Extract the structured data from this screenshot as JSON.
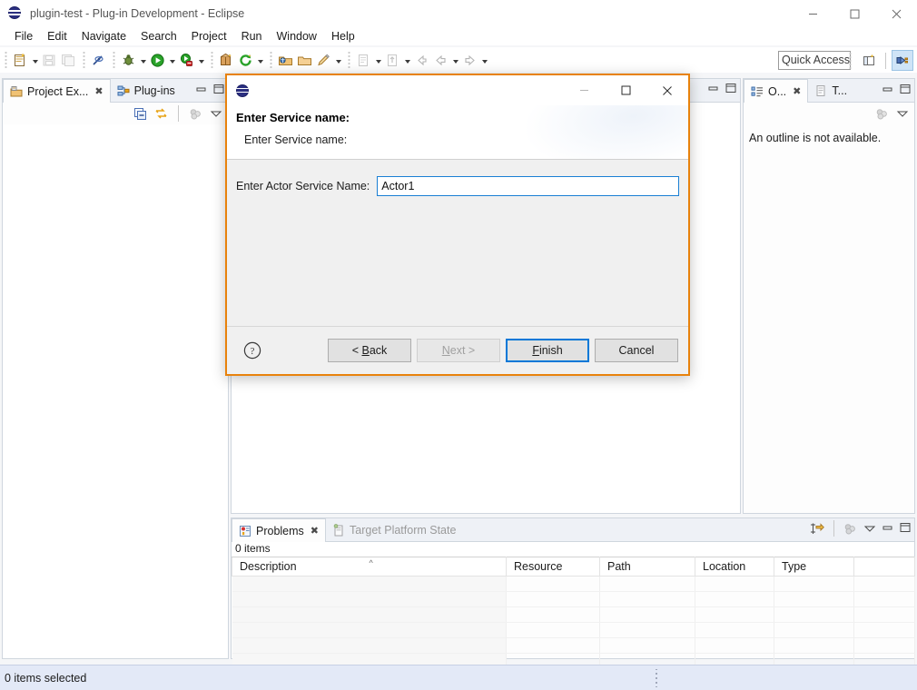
{
  "window": {
    "title": "plugin-test - Plug-in Development - Eclipse",
    "icon": "eclipse-globe-icon",
    "controls": [
      {
        "name": "minimize-button",
        "glyph": "minimize-icon"
      },
      {
        "name": "maximize-button",
        "glyph": "maximize-icon"
      },
      {
        "name": "close-button",
        "glyph": "close-icon"
      }
    ]
  },
  "menubar": {
    "items": [
      {
        "label": "File"
      },
      {
        "label": "Edit"
      },
      {
        "label": "Navigate"
      },
      {
        "label": "Search"
      },
      {
        "label": "Project"
      },
      {
        "label": "Run"
      },
      {
        "label": "Window"
      },
      {
        "label": "Help"
      }
    ]
  },
  "toolbar": {
    "quick_access_placeholder": "Quick Access",
    "buttons": [
      {
        "name": "new-wizard-button",
        "icon": "new-document-icon",
        "dropdown": true
      },
      {
        "name": "save-button",
        "icon": "save-disk-icon",
        "disabled": true
      },
      {
        "name": "save-all-button",
        "icon": "save-all-icon",
        "disabled": true
      },
      {
        "name": "toggle-mark-occurrences-button",
        "icon": "mark-occurrences-icon"
      },
      {
        "name": "debug-button",
        "icon": "bug-icon",
        "dropdown": true
      },
      {
        "name": "run-button",
        "icon": "run-green-play-icon",
        "dropdown": true
      },
      {
        "name": "run-external-tools-button",
        "icon": "external-tools-icon",
        "dropdown": true
      },
      {
        "name": "new-plugin-project-button",
        "icon": "plugin-package-icon"
      },
      {
        "name": "open-type-button",
        "icon": "refresh-green-icon",
        "dropdown": true
      },
      {
        "name": "open-package-button",
        "icon": "open-package-icon"
      },
      {
        "name": "open-folder-button",
        "icon": "open-folder-icon"
      },
      {
        "name": "edit-button",
        "icon": "pencil-icon",
        "dropdown": true
      },
      {
        "name": "new-java-file-button",
        "icon": "java-file-icon",
        "dropdown": true
      },
      {
        "name": "next-annotation-button",
        "icon": "next-annotation-icon",
        "dropdown": true
      },
      {
        "name": "previous-edit-location-button",
        "icon": "back-edit-icon"
      },
      {
        "name": "back-button",
        "icon": "arrow-left-icon",
        "dropdown": true
      },
      {
        "name": "forward-button",
        "icon": "arrow-right-icon",
        "dropdown": true
      }
    ],
    "perspective": {
      "open_perspective_name": "open-perspective-icon",
      "active_perspective_name": "plug-in-development-perspective-icon"
    }
  },
  "left_panel": {
    "tabs": [
      {
        "label": "Project Ex...",
        "icon": "project-explorer-icon",
        "active": true,
        "closable": true
      },
      {
        "label": "Plug-ins",
        "icon": "plugins-icon",
        "active": false,
        "closable": false
      }
    ],
    "tab_controls": [
      {
        "name": "minimize-view-button",
        "glyph": "minimize-icon"
      },
      {
        "name": "maximize-view-button",
        "glyph": "maximize-icon"
      }
    ],
    "view_toolbar": [
      {
        "name": "collapse-all-button",
        "icon": "collapse-all-icon"
      },
      {
        "name": "link-with-editor-button",
        "icon": "link-with-editor-icon"
      },
      {
        "name": "view-menu-button",
        "icon": "view-menu-icon"
      },
      {
        "name": "view-dropdown-button",
        "icon": "chevron-down-icon"
      }
    ],
    "content": ""
  },
  "editor_area": {
    "controls": [
      {
        "name": "minimize-editor-button",
        "glyph": "minimize-icon"
      },
      {
        "name": "maximize-editor-button",
        "glyph": "maximize-icon"
      }
    ]
  },
  "outline_panel": {
    "tabs": [
      {
        "label": "O...",
        "icon": "outline-icon",
        "active": true,
        "closable": true
      },
      {
        "label": "T...",
        "icon": "task-list-icon",
        "active": false,
        "closable": false
      }
    ],
    "tab_controls": [
      {
        "name": "minimize-view-button",
        "glyph": "minimize-icon"
      },
      {
        "name": "maximize-view-button",
        "glyph": "maximize-icon"
      }
    ],
    "view_toolbar": [
      {
        "name": "view-menu-button",
        "icon": "view-menu-icon"
      },
      {
        "name": "view-dropdown-button",
        "icon": "chevron-down-icon"
      }
    ],
    "message": "An outline is not available."
  },
  "problems_panel": {
    "tabs": [
      {
        "label": "Problems",
        "icon": "problems-icon",
        "active": true,
        "closable": true
      },
      {
        "label": "Target Platform State",
        "icon": "target-platform-icon",
        "active": false,
        "closable": false
      }
    ],
    "tab_controls": [
      {
        "name": "focus-on-selection-button",
        "icon": "focus-selection-icon"
      },
      {
        "name": "view-menu-button",
        "icon": "view-menu-icon"
      },
      {
        "name": "view-dropdown-button",
        "icon": "chevron-down-icon"
      },
      {
        "name": "minimize-view-button",
        "glyph": "minimize-icon"
      },
      {
        "name": "maximize-view-button",
        "glyph": "maximize-icon"
      }
    ],
    "items_count": "0 items",
    "columns": [
      {
        "label": "Description",
        "sorted": true,
        "sort_dir": "asc"
      },
      {
        "label": "Resource",
        "sorted": false
      },
      {
        "label": "Path",
        "sorted": false
      },
      {
        "label": "Location",
        "sorted": false
      },
      {
        "label": "Type",
        "sorted": false
      }
    ],
    "rows": []
  },
  "statusbar": {
    "text": "0 items selected"
  },
  "dialog": {
    "icon": "eclipse-globe-icon",
    "title": "Enter Service name:",
    "subtitle": "Enter Service name:",
    "controls": [
      {
        "name": "minimize-button",
        "glyph": "minimize-icon",
        "disabled": true
      },
      {
        "name": "maximize-button",
        "glyph": "maximize-icon",
        "disabled": false
      },
      {
        "name": "close-button",
        "glyph": "close-icon",
        "disabled": false
      }
    ],
    "field": {
      "label": "Enter Actor Service Name:",
      "value": "Actor1",
      "placeholder": ""
    },
    "help_icon": "help-question-icon",
    "buttons": {
      "back": "< Back",
      "next": "Next >",
      "finish": "Finish",
      "cancel": "Cancel"
    }
  },
  "colors": {
    "focus_border": "#e8820c",
    "default_button_border": "#0078d7",
    "input_border": "#1a7fd4",
    "statusbar_bg": "#e3e9f7",
    "tab_bg": "#eef1f6"
  }
}
